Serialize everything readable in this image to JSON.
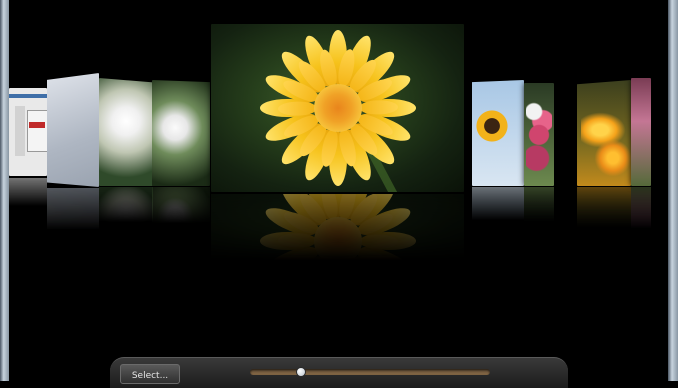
{
  "controls": {
    "select_label": "Select...",
    "slider_position": 0.2
  },
  "gallery": {
    "selected_photo": "yellow-daisy",
    "photos": [
      "screenshot-thumbnail",
      "paper-texture",
      "white-chrysanthemum",
      "white-lily",
      "yellow-daisy",
      "sunflower",
      "pink-snapdragons",
      "orange-flowers",
      "pink-blossoms"
    ]
  }
}
